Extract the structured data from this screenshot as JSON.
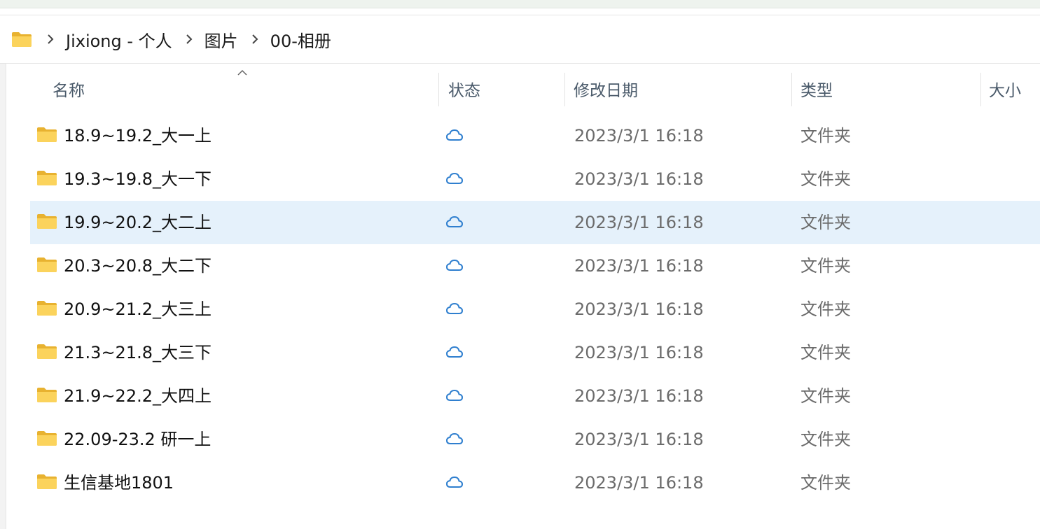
{
  "breadcrumb": {
    "items": [
      "Jixiong - 个人",
      "图片",
      "00-相册"
    ]
  },
  "columns": {
    "name": "名称",
    "status": "状态",
    "modified": "修改日期",
    "type": "类型",
    "size": "大小"
  },
  "icons": {
    "folder": "folder-icon",
    "status": "cloud-icon",
    "separator": "chevron-right-icon",
    "sort": "sort-up-icon"
  },
  "colors": {
    "folder": "#f7c94a",
    "cloud": "#2f7fcf",
    "selected_row": "#e5f1fb"
  },
  "files": [
    {
      "name": "18.9~19.2_大一上",
      "date": "2023/3/1 16:18",
      "type": "文件夹"
    },
    {
      "name": "19.3~19.8_大一下",
      "date": "2023/3/1 16:18",
      "type": "文件夹"
    },
    {
      "name": "19.9~20.2_大二上",
      "date": "2023/3/1 16:18",
      "type": "文件夹"
    },
    {
      "name": "20.3~20.8_大二下",
      "date": "2023/3/1 16:18",
      "type": "文件夹"
    },
    {
      "name": "20.9~21.2_大三上",
      "date": "2023/3/1 16:18",
      "type": "文件夹"
    },
    {
      "name": "21.3~21.8_大三下",
      "date": "2023/3/1 16:18",
      "type": "文件夹"
    },
    {
      "name": "21.9~22.2_大四上",
      "date": "2023/3/1 16:18",
      "type": "文件夹"
    },
    {
      "name": "22.09-23.2 研一上",
      "date": "2023/3/1 16:18",
      "type": "文件夹"
    },
    {
      "name": "生信基地1801",
      "date": "2023/3/1 16:18",
      "type": "文件夹"
    }
  ]
}
